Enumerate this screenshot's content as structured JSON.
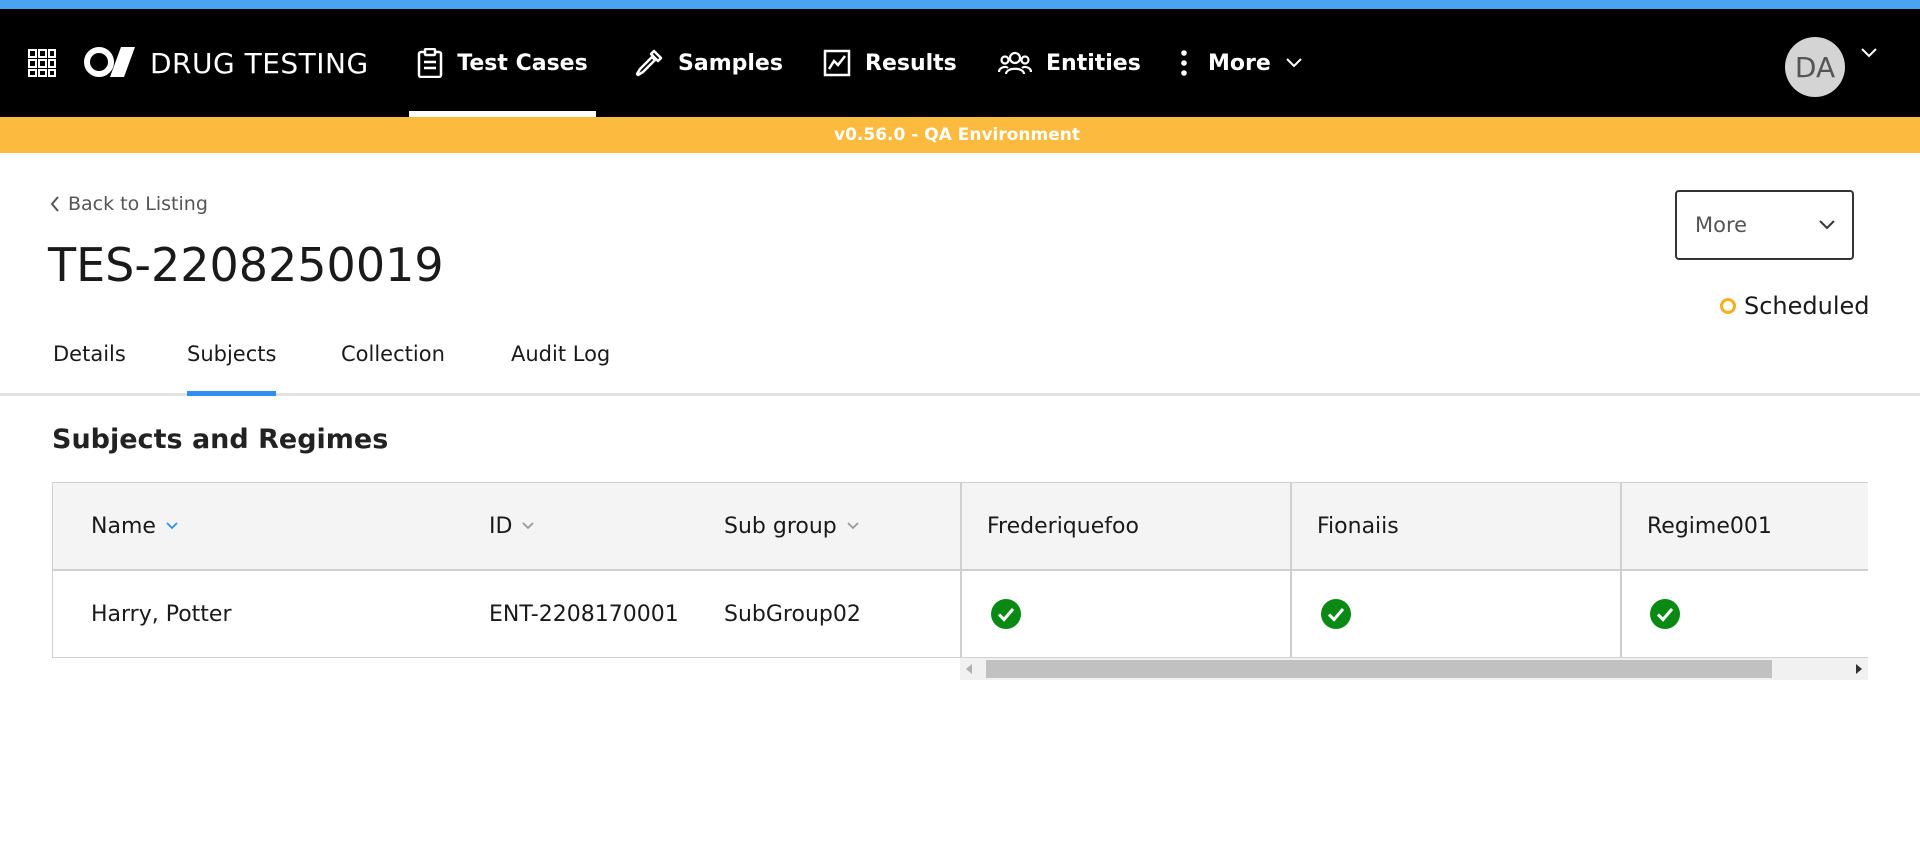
{
  "app": {
    "brand": "DRUG TESTING",
    "apps_icon": "grid-icon",
    "logo_icon": "logo-mark-icon"
  },
  "nav": {
    "items": [
      {
        "label": "Test Cases",
        "icon": "clipboard-icon",
        "active": true
      },
      {
        "label": "Samples",
        "icon": "pipette-icon",
        "active": false
      },
      {
        "label": "Results",
        "icon": "chart-icon",
        "active": false
      },
      {
        "label": "Entities",
        "icon": "users-icon",
        "active": false
      },
      {
        "label": "More",
        "icon": "kebab-icon",
        "active": false
      }
    ],
    "user_initials": "DA"
  },
  "env_banner": "v0.56.0 - QA Environment",
  "page": {
    "back_label": "Back to Listing",
    "title": "TES-2208250019",
    "more_button": "More",
    "status": "Scheduled"
  },
  "tabs": [
    {
      "label": "Details",
      "active": false
    },
    {
      "label": "Subjects",
      "active": true
    },
    {
      "label": "Collection",
      "active": false
    },
    {
      "label": "Audit Log",
      "active": false
    }
  ],
  "section_title": "Subjects and Regimes",
  "table": {
    "columns": [
      {
        "label": "Name",
        "sortable": true
      },
      {
        "label": "ID",
        "sortable": true
      },
      {
        "label": "Sub group",
        "sortable": true
      },
      {
        "label": "Frederiquefoo",
        "sortable": false
      },
      {
        "label": "Fionaiis",
        "sortable": false
      },
      {
        "label": "Regime001",
        "sortable": false
      }
    ],
    "rows": [
      {
        "name": "Harry, Potter",
        "id": "ENT-2208170001",
        "sub_group": "SubGroup02",
        "regimes": [
          true,
          true,
          true
        ]
      }
    ]
  },
  "colors": {
    "accent_blue": "#2f8ff0",
    "env_yellow": "#fcbb3f",
    "status_ring": "#f5b01e",
    "check_green": "#0a8a14"
  }
}
